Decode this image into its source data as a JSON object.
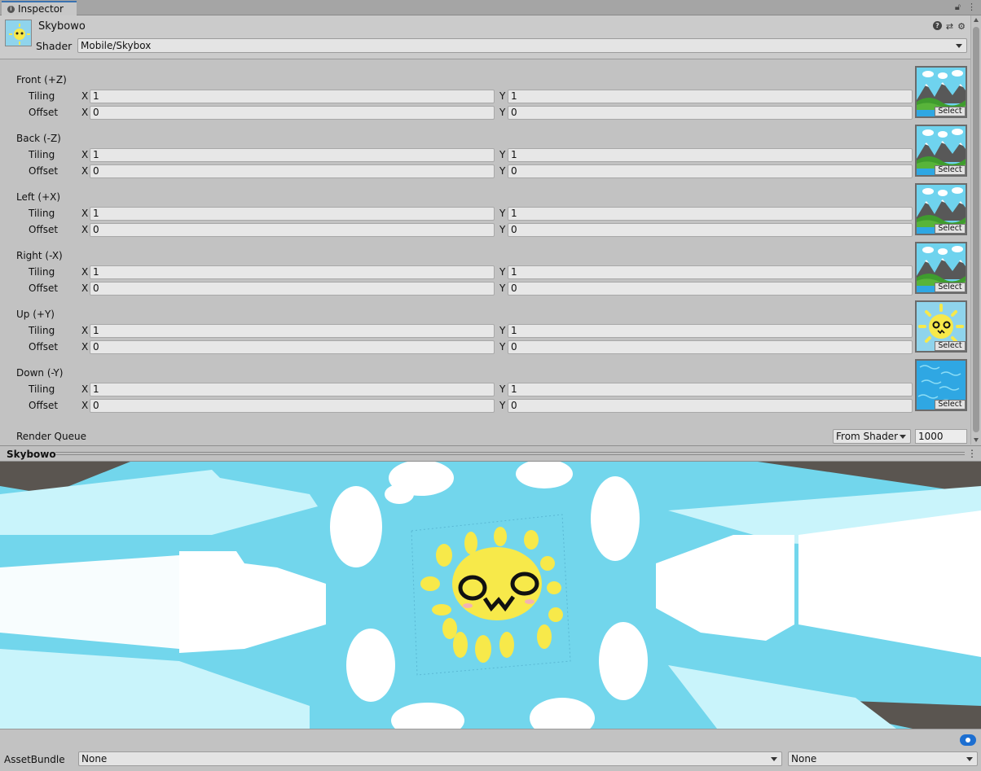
{
  "tab": {
    "title": "Inspector"
  },
  "header": {
    "asset_name": "Skybowo",
    "shader_label": "Shader",
    "shader_value": "Mobile/Skybox"
  },
  "textures": [
    {
      "title": "Front (+Z)",
      "tiling_label": "Tiling",
      "offset_label": "Offset",
      "tiling_x": "1",
      "tiling_y": "1",
      "offset_x": "0",
      "offset_y": "0",
      "thumb": "mountains"
    },
    {
      "title": "Back (-Z)",
      "tiling_label": "Tiling",
      "offset_label": "Offset",
      "tiling_x": "1",
      "tiling_y": "1",
      "offset_x": "0",
      "offset_y": "0",
      "thumb": "mountains"
    },
    {
      "title": "Left (+X)",
      "tiling_label": "Tiling",
      "offset_label": "Offset",
      "tiling_x": "1",
      "tiling_y": "1",
      "offset_x": "0",
      "offset_y": "0",
      "thumb": "mountains"
    },
    {
      "title": "Right (-X)",
      "tiling_label": "Tiling",
      "offset_label": "Offset",
      "tiling_x": "1",
      "tiling_y": "1",
      "offset_x": "0",
      "offset_y": "0",
      "thumb": "mountains"
    },
    {
      "title": "Up (+Y)",
      "tiling_label": "Tiling",
      "offset_label": "Offset",
      "tiling_x": "1",
      "tiling_y": "1",
      "offset_x": "0",
      "offset_y": "0",
      "thumb": "sun"
    },
    {
      "title": "Down (-Y)",
      "tiling_label": "Tiling",
      "offset_label": "Offset",
      "tiling_x": "1",
      "tiling_y": "1",
      "offset_x": "0",
      "offset_y": "0",
      "thumb": "water"
    }
  ],
  "axis": {
    "x": "X",
    "y": "Y"
  },
  "select_label": "Select",
  "render_queue": {
    "label": "Render Queue",
    "mode": "From Shader",
    "value": "1000"
  },
  "preview": {
    "title": "Skybowo"
  },
  "asset_bundle": {
    "label": "AssetBundle",
    "name": "None",
    "variant": "None"
  },
  "colors": {
    "sky": "#72d6ec",
    "sun": "#f7e94a",
    "cloud": "#ffffff",
    "tab_accent": "#3a72b0",
    "tag": "#1d6fd1"
  }
}
